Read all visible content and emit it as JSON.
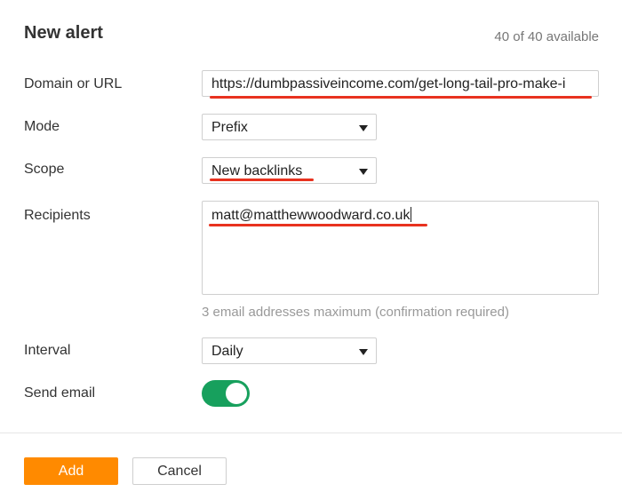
{
  "dialog": {
    "title": "New alert",
    "available": "40 of 40 available"
  },
  "fields": {
    "domain": {
      "label": "Domain or URL",
      "value": "https://dumbpassiveincome.com/get-long-tail-pro-make-i"
    },
    "mode": {
      "label": "Mode",
      "selected": "Prefix"
    },
    "scope": {
      "label": "Scope",
      "selected": "New backlinks"
    },
    "recipients": {
      "label": "Recipients",
      "value": "matt@matthewwoodward.co.uk",
      "hint": "3 email addresses maximum (confirmation required)"
    },
    "interval": {
      "label": "Interval",
      "selected": "Daily"
    },
    "send_email": {
      "label": "Send email",
      "enabled": true
    }
  },
  "buttons": {
    "add": "Add",
    "cancel": "Cancel"
  },
  "colors": {
    "accent": "#ff8a00",
    "toggle_on": "#17a05d",
    "annotation": "#e8321f"
  },
  "icons": {
    "select_caret": "chevron-down-icon"
  }
}
